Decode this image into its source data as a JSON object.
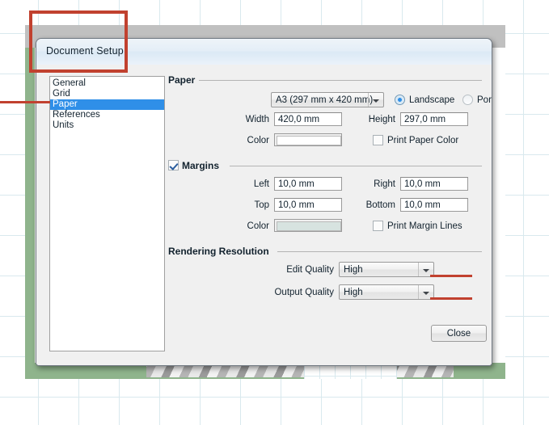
{
  "dialog": {
    "title": "Document Setup",
    "close_label": "Close"
  },
  "sidebar": {
    "items": [
      {
        "label": "General",
        "selected": false
      },
      {
        "label": "Grid",
        "selected": false
      },
      {
        "label": "Paper",
        "selected": true
      },
      {
        "label": "References",
        "selected": false
      },
      {
        "label": "Units",
        "selected": false
      }
    ]
  },
  "paper": {
    "group_label": "Paper",
    "size_value": "A3 (297 mm x 420 mm)",
    "orientation": {
      "landscape_label": "Landscape",
      "portrait_label": "Portrait",
      "selected": "Landscape"
    },
    "width_label": "Width",
    "width_value": "420,0 mm",
    "height_label": "Height",
    "height_value": "297,0 mm",
    "color_label": "Color",
    "color_value": "#ffffff",
    "print_paper_color_label": "Print Paper Color",
    "print_paper_color_checked": false
  },
  "margins": {
    "group_label": "Margins",
    "enabled": true,
    "left_label": "Left",
    "left_value": "10,0 mm",
    "right_label": "Right",
    "right_value": "10,0 mm",
    "top_label": "Top",
    "top_value": "10,0 mm",
    "bottom_label": "Bottom",
    "bottom_value": "10,0 mm",
    "color_label": "Color",
    "color_value": "#d7e3e0",
    "print_margin_lines_label": "Print Margin Lines",
    "print_margin_lines_checked": false
  },
  "rendering": {
    "group_label": "Rendering Resolution",
    "edit_quality_label": "Edit Quality",
    "edit_quality_value": "High",
    "output_quality_label": "Output Quality",
    "output_quality_value": "High"
  },
  "annotations": {
    "color": "#c1412f",
    "title_highlight": "rectangle around Document Setup title",
    "paper_pointer": "line pointing at Paper list item",
    "edit_quality_pointer": "line pointing at Edit Quality combo",
    "output_quality_pointer": "line pointing at Output Quality combo"
  },
  "colors": {
    "accent_selection": "#2f8fe8",
    "annotation_red": "#c1412f",
    "canvas_grid": "#d9e9ee",
    "app_chrome": "#c0c0c0",
    "green_band": "#8fb48c"
  }
}
